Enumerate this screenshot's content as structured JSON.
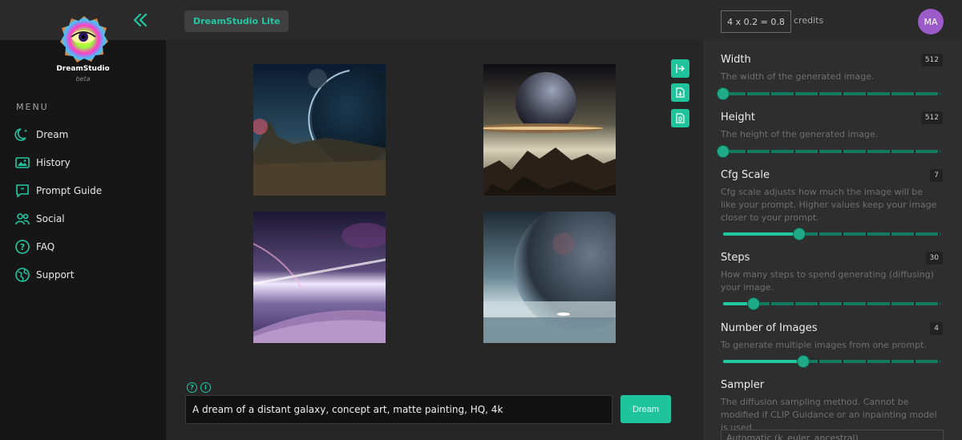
{
  "brand": {
    "name": "DreamStudio",
    "sub": "beta"
  },
  "menu": {
    "title": "MENU",
    "items": [
      {
        "label": "Dream",
        "icon": "dream-moon-icon"
      },
      {
        "label": "History",
        "icon": "history-image-icon"
      },
      {
        "label": "Prompt Guide",
        "icon": "prompt-guide-quote-icon"
      },
      {
        "label": "Social",
        "icon": "social-people-icon"
      },
      {
        "label": "FAQ",
        "icon": "faq-question-icon"
      },
      {
        "label": "Support",
        "icon": "support-globe-icon"
      }
    ]
  },
  "header": {
    "pill": "DreamStudio Lite",
    "credits_formula": "4 x 0.2 = 0.8",
    "credits_label": "credits",
    "avatar": "MA"
  },
  "prompt": {
    "value": "A dream of a distant galaxy, concept art, matte painting, HQ, 4k",
    "button": "Dream"
  },
  "settings": {
    "width": {
      "title": "Width",
      "value": "512",
      "desc": "The width of the generated image.",
      "fraction": 0.0
    },
    "height": {
      "title": "Height",
      "value": "512",
      "desc": "The height of the generated image.",
      "fraction": 0.0
    },
    "cfg": {
      "title": "Cfg Scale",
      "value": "7",
      "desc": "Cfg scale adjusts how much the image will be like your prompt. Higher values keep your image closer to your prompt.",
      "fraction": 0.35
    },
    "steps": {
      "title": "Steps",
      "value": "30",
      "desc": "How many steps to spend generating (diffusing) your image.",
      "fraction": 0.14
    },
    "images": {
      "title": "Number of Images",
      "value": "4",
      "desc": "To generate multiple images from one prompt.",
      "fraction": 0.37
    },
    "sampler": {
      "title": "Sampler",
      "desc": "The diffusion sampling method. Cannot be modified if CLIP Guidance or an inpainting model is used.",
      "selected": "Automatic (k_euler_ancestral)"
    }
  },
  "colors": {
    "accent": "#20c49c",
    "avatar": "#9b5bc8"
  }
}
